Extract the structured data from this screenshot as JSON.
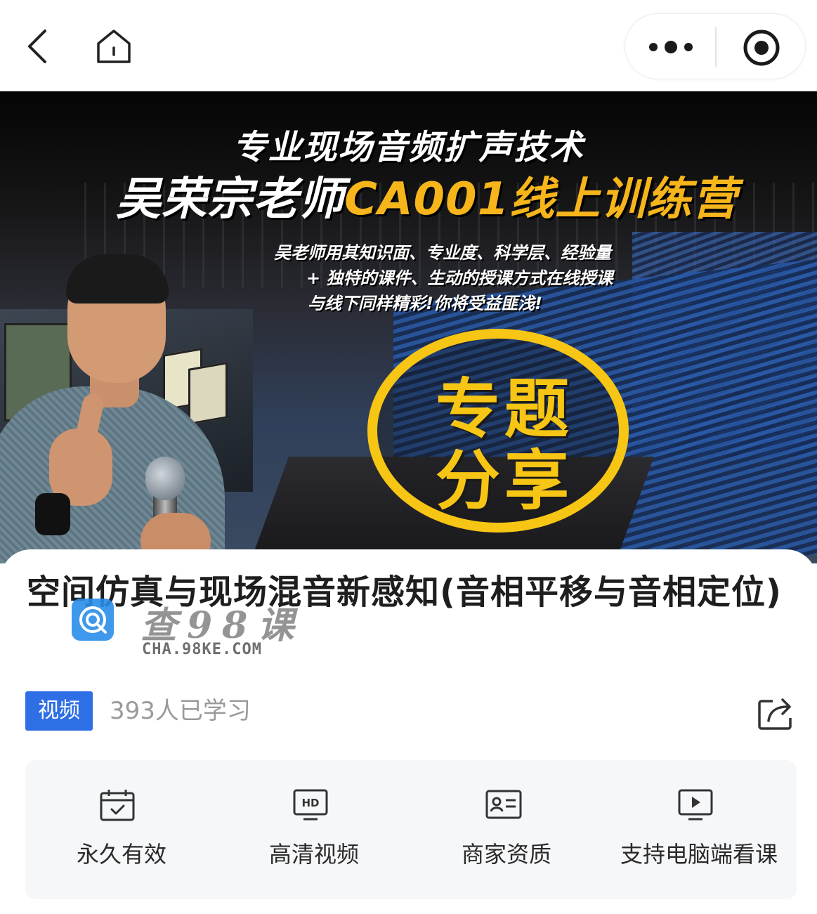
{
  "banner": {
    "title_line1": "专业现场音频扩声技术",
    "title_line2_white": "吴荣宗老师",
    "title_line2_yellow": "CA001线上训练营",
    "sub_line1": "吴老师用其知识面、专业度、科学层、经验量",
    "sub_line2": "+ 独特的课件、生动的授课方式在线授课",
    "sub_line3": "与线下同样精彩!你将受益匪浅!",
    "badge_line1": "专题",
    "badge_line2": "分享",
    "accent_color": "#f7c514"
  },
  "course": {
    "title": "空间仿真与现场混音新感知(音相平移与音相定位)",
    "tag": "视频",
    "learners": "393人已学习"
  },
  "watermark": {
    "cn": "查98课",
    "en": "CHA.98KE.COM"
  },
  "features": [
    {
      "icon": "calendar-check-icon",
      "label": "永久有效"
    },
    {
      "icon": "hd-icon",
      "label": "高清视频"
    },
    {
      "icon": "id-card-icon",
      "label": "商家资质"
    },
    {
      "icon": "monitor-play-icon",
      "label": "支持电脑端看课"
    }
  ],
  "colors": {
    "tag_blue": "#2f6fe6",
    "muted_text": "#9a9a9a",
    "feature_bg": "#f6f7f9"
  }
}
